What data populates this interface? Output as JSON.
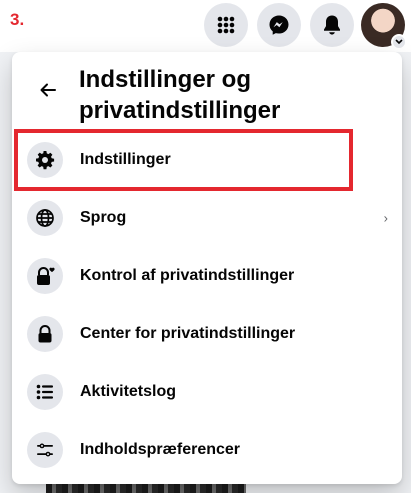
{
  "step_label": "3.",
  "topbar": {
    "icons": [
      "menu-grid-icon",
      "messenger-icon",
      "bell-icon",
      "avatar"
    ]
  },
  "panel": {
    "title": "Indstillinger og privatindstillinger",
    "back_icon": "arrow-left-icon",
    "items": [
      {
        "label": "Indstillinger",
        "icon": "gear-icon",
        "highlighted": true
      },
      {
        "label": "Sprog",
        "icon": "globe-icon",
        "has_chevron": true
      },
      {
        "label": "Kontrol af privatindstillinger",
        "icon": "lock-heart-icon"
      },
      {
        "label": "Center for privatindstillinger",
        "icon": "lock-icon"
      },
      {
        "label": "Aktivitetslog",
        "icon": "list-icon"
      },
      {
        "label": "Indholdspræferencer",
        "icon": "sliders-icon"
      }
    ],
    "chevron_glyph": "›"
  },
  "colors": {
    "highlight": "#e4282f",
    "icon_bg": "#e4e6eb",
    "text": "#050505"
  }
}
